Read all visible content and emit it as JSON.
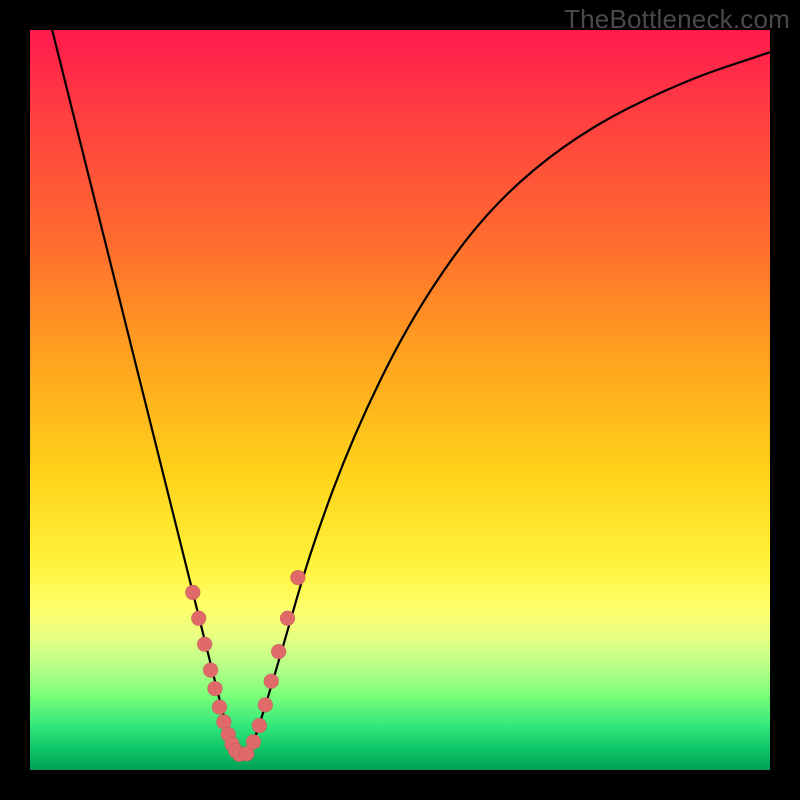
{
  "watermark": "TheBottleneck.com",
  "chart_data": {
    "type": "line",
    "title": "",
    "xlabel": "",
    "ylabel": "",
    "xlim": [
      0,
      100
    ],
    "ylim": [
      0,
      100
    ],
    "curve": {
      "name": "bottleneck-curve",
      "x": [
        3,
        6,
        10,
        14,
        18,
        21,
        23,
        25,
        26.5,
        28,
        29.5,
        31,
        34,
        38,
        44,
        52,
        62,
        74,
        88,
        100
      ],
      "y": [
        100,
        88,
        72,
        56,
        40,
        28,
        20,
        12,
        6,
        2,
        2,
        6,
        16,
        30,
        46,
        62,
        76,
        86,
        93,
        97
      ]
    },
    "points_left_branch": {
      "name": "markers-left",
      "x": [
        22.0,
        22.8,
        23.6,
        24.4,
        25.0,
        25.6,
        26.2,
        26.8,
        27.3,
        27.8,
        28.3
      ],
      "y": [
        24.0,
        20.5,
        17.0,
        13.5,
        11.0,
        8.5,
        6.5,
        4.8,
        3.5,
        2.6,
        2.1
      ]
    },
    "points_right_branch": {
      "name": "markers-right",
      "x": [
        29.3,
        30.2,
        31.0,
        31.8,
        32.6,
        33.6,
        34.8,
        36.2
      ],
      "y": [
        2.2,
        3.8,
        6.0,
        8.8,
        12.0,
        16.0,
        20.5,
        26.0
      ]
    },
    "gradient_stops": [
      {
        "pos": 0,
        "color": "#ff1a4d"
      },
      {
        "pos": 28,
        "color": "#ff6a2f"
      },
      {
        "pos": 60,
        "color": "#ffd31a"
      },
      {
        "pos": 78,
        "color": "#ffff6a"
      },
      {
        "pos": 90,
        "color": "#7aff7a"
      },
      {
        "pos": 100,
        "color": "#00a055"
      }
    ]
  }
}
